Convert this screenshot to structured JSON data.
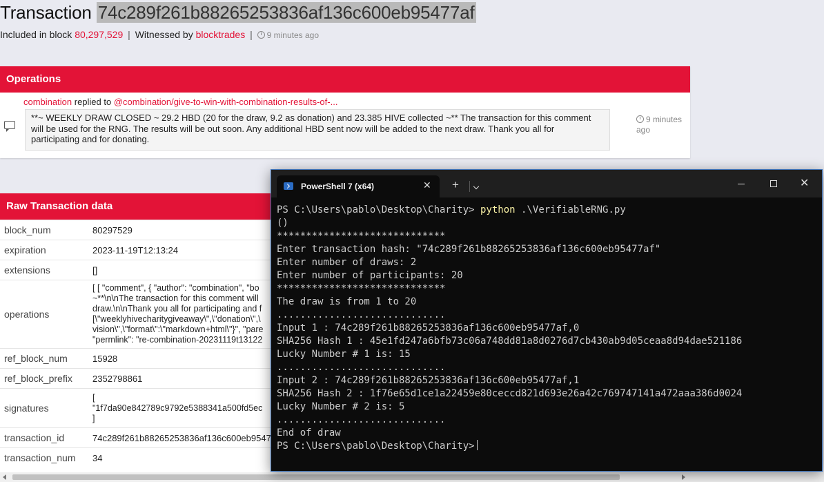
{
  "header": {
    "title_label": "Transaction",
    "tx_hash": "74c289f261b88265253836af136c600eb95477af",
    "included_label": "Included in block",
    "block_number": "80,297,529",
    "witnessed_label": "Witnessed by",
    "witness": "blocktrades",
    "time_ago": "9 minutes ago"
  },
  "operations": {
    "heading": "Operations",
    "author": "combination",
    "action": "replied to",
    "target": "@combination/give-to-win-with-combination-results-of-...",
    "body": "**~ WEEKLY DRAW CLOSED ~ 29.2 HBD (20 for the draw, 9.2 as donation) and 23.385 HIVE collected ~** The transaction for this comment will be used for the RNG. The results will be out soon. Any additional HBD sent now will be added to the next draw. Thank you all for participating and for donating.",
    "time_ago": "9 minutes ago"
  },
  "raw": {
    "heading": "Raw Transaction data",
    "rows": [
      {
        "key": "block_num",
        "value": "80297529"
      },
      {
        "key": "expiration",
        "value": "2023-11-19T12:13:24"
      },
      {
        "key": "extensions",
        "value": "[]"
      },
      {
        "key": "operations",
        "lines": [
          "[ [ \"comment\", { \"author\": \"combination\", \"bo",
          "~**\\n\\nThe transaction for this comment will",
          "draw.\\n\\nThank you all for participating and f",
          "[\\\"weeklyhivecharitygiveaway\\\",\\\"donation\\\",\\",
          "vision\\\",\\\"format\\\":\\\"markdown+html\\\"}\", \"pare",
          "\"permlink\": \"re-combination-20231119t13122"
        ]
      },
      {
        "key": "ref_block_num",
        "value": "15928"
      },
      {
        "key": "ref_block_prefix",
        "value": "2352798861"
      },
      {
        "key": "signatures",
        "lines": [
          "[",
          "\"1f7da90e842789c9792e5388341a500fd5ec",
          "]"
        ]
      },
      {
        "key": "transaction_id",
        "value": "74c289f261b88265253836af136c600eb9547"
      },
      {
        "key": "transaction_num",
        "value": "34"
      }
    ]
  },
  "terminal": {
    "tab_title": "PowerShell 7 (x64)",
    "tab_close": "✕",
    "new_tab": "+",
    "window_close": "✕",
    "prompt": "PS C:\\Users\\pablo\\Desktop\\Charity>",
    "command": "python",
    "command_args": ".\\VerifiableRNG.py",
    "lines": [
      "()",
      "*****************************",
      "Enter transaction hash: \"74c289f261b88265253836af136c600eb95477af\"",
      "Enter number of draws: 2",
      "Enter number of participants: 20",
      "*****************************",
      "The draw is from 1 to 20",
      ".............................",
      "Input 1 : 74c289f261b88265253836af136c600eb95477af,0",
      "SHA256 Hash 1 : 45e1fd247a6bfb73c06a748dd81a8d0276d7cb430ab9d05ceaa8d94dae521186",
      "Lucky Number # 1 is: 15",
      ".............................",
      "Input 2 : 74c289f261b88265253836af136c600eb95477af,1",
      "SHA256 Hash 2 : 1f76e65d1ce1a22459e80ceccd821d693e26a42c769747141a472aaa386d0024",
      "Lucky Number # 2 is: 5",
      ".............................",
      "End of draw"
    ],
    "final_prompt": "PS C:\\Users\\pablo\\Desktop\\Charity>"
  },
  "colors": {
    "accent": "#e31337",
    "terminal_bg": "#0c0c0c",
    "terminal_text": "#cccccc",
    "command_text": "#f9f1a5"
  }
}
